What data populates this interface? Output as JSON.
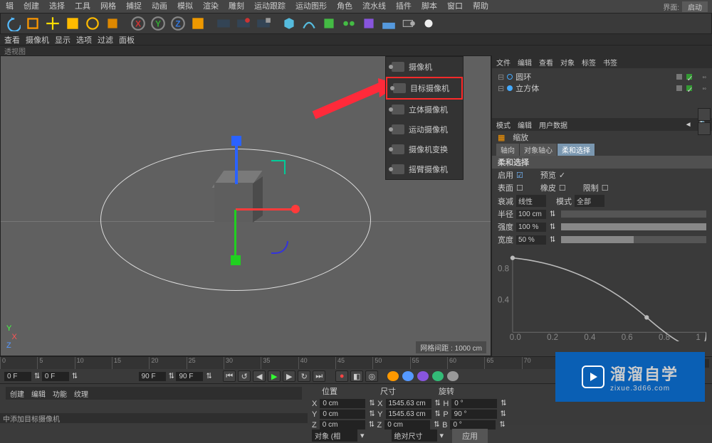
{
  "topright": {
    "label": "界面:",
    "button": "启动"
  },
  "menubar": [
    "辑",
    "创建",
    "选择",
    "工具",
    "网格",
    "捕捉",
    "动画",
    "模拟",
    "渲染",
    "雕刻",
    "运动跟踪",
    "运动图形",
    "角色",
    "流水线",
    "插件",
    "脚本",
    "窗口",
    "帮助"
  ],
  "viewtabs": [
    "查看",
    "摄像机",
    "显示",
    "选项",
    "过滤",
    "面板"
  ],
  "viewlabel": "透视图",
  "gridinfo": "网格间距 : 1000 cm",
  "camdrop": {
    "items": [
      "摄像机",
      "目标摄像机",
      "立体摄像机",
      "运动摄像机",
      "摄像机变换",
      "摇臂摄像机"
    ],
    "highlight_index": 1
  },
  "objpanel": {
    "tabs": [
      "文件",
      "编辑",
      "查看",
      "对象",
      "标签",
      "书签"
    ],
    "items": [
      {
        "name": "圆环",
        "icon": "ring"
      },
      {
        "name": "立方体",
        "icon": "cube"
      }
    ]
  },
  "attr": {
    "tabs": [
      "模式",
      "编辑",
      "用户数据"
    ],
    "title": "缩放",
    "subtabs": [
      "轴向",
      "对象轴心",
      "柔和选择"
    ],
    "section": "柔和选择",
    "rows": {
      "enable_l": "启用",
      "preview_l": "预览",
      "surface_l": "表面",
      "rubber_l": "橡皮",
      "limit_l": "限制",
      "falloff_l": "衰减",
      "falloff_v": "线性",
      "mode_l": "模式",
      "mode_v": "全部",
      "radius_l": "半径",
      "radius_v": "100 cm",
      "strength_l": "强度",
      "strength_v": "100 %",
      "width_l": "宽度",
      "width_v": "50 %"
    },
    "curve_ticks_x": [
      "0.0",
      "0.2",
      "0.4",
      "0.6",
      "0.8",
      "1"
    ],
    "curve_ticks_y": [
      "0.4",
      "0.8"
    ]
  },
  "timeline": {
    "start": 0,
    "end": 90,
    "step": 5,
    "label": "0 F"
  },
  "transport": {
    "a": "0 F",
    "b": "0 F",
    "c": "90 F",
    "d": "90 F"
  },
  "bottom_tabs": [
    "创建",
    "编辑",
    "功能",
    "纹理"
  ],
  "coords": {
    "headers": [
      "位置",
      "尺寸",
      "旋转"
    ],
    "rows": [
      {
        "axis": "X",
        "p": "0 cm",
        "s": "1545.63 cm",
        "rl": "H",
        "r": "0 °"
      },
      {
        "axis": "Y",
        "p": "0 cm",
        "s": "1545.63 cm",
        "rl": "P",
        "r": "90 °"
      },
      {
        "axis": "Z",
        "p": "0 cm",
        "s": "0 cm",
        "rl": "B",
        "r": "0 °"
      }
    ],
    "sel1": "对象 (相",
    "sel2": "绝对尺寸",
    "apply": "应用"
  },
  "status": "中添加目标摄像机",
  "watermark": {
    "title": "溜溜自学",
    "url": "zixue.3d66.com"
  }
}
